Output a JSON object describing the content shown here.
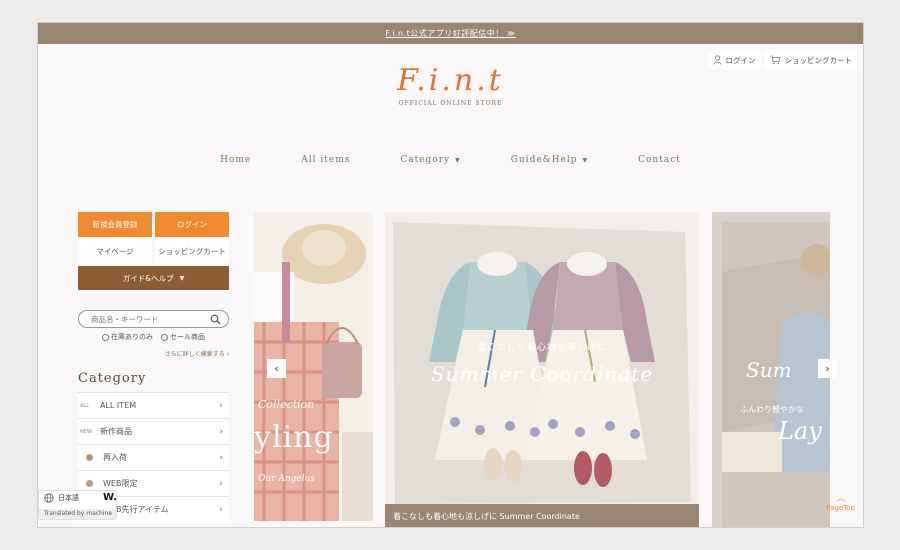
{
  "topbar": {
    "announcement": "F.i.n.t公式アプリ好評配信中！ ≫"
  },
  "header": {
    "login_label": "ログイン",
    "cart_label": "ショッピングカート",
    "logo_text": "F.i.n.t",
    "logo_subtitle": "OFFICIAL ONLINE STORE"
  },
  "nav": {
    "items": [
      {
        "label": "Home"
      },
      {
        "label": "All items"
      },
      {
        "label": "Category"
      },
      {
        "label": "Guide&Help"
      },
      {
        "label": "Contact"
      }
    ]
  },
  "sidebar": {
    "register_label": "新規会員登録",
    "login_label": "ログイン",
    "mypage_label": "マイページ",
    "cart_label": "ショッピングカート",
    "guide_label": "ガイド&ヘルプ",
    "search_placeholder": "商品名・キーワード",
    "filter_stock": "在庫ありのみ",
    "filter_sale": "セール商品",
    "advanced_search": "さらに詳しく検索する",
    "category_title": "Category",
    "categories": [
      {
        "tag": "ALL",
        "label": "ALL ITEM"
      },
      {
        "tag": "NEW",
        "label": "新作商品"
      },
      {
        "tag": "",
        "label": "再入荷"
      },
      {
        "tag": "",
        "label": "WEB限定"
      },
      {
        "tag": "",
        "label": "WEB先行アイテム"
      }
    ]
  },
  "carousel": {
    "left_text": "yling",
    "left_script": "Collection",
    "left_sub": "Our Angelus",
    "main_overlay_jp": "着こなしも着心地も涼しげに",
    "main_overlay_en": "Summer Coordinate",
    "main_caption": "着こなしも着心地も涼しげに Summer Coordinate",
    "right_text": "Lay",
    "right_script": "Sum",
    "right_sub": "ふんわり軽やかな"
  },
  "pagetop": {
    "label": "PageTop"
  },
  "translate": {
    "language": "日本語",
    "footer": "Translated by machine"
  },
  "colors": {
    "accent": "#ef8a2e",
    "brown": "#8e5d34",
    "bar": "#9a8570"
  }
}
